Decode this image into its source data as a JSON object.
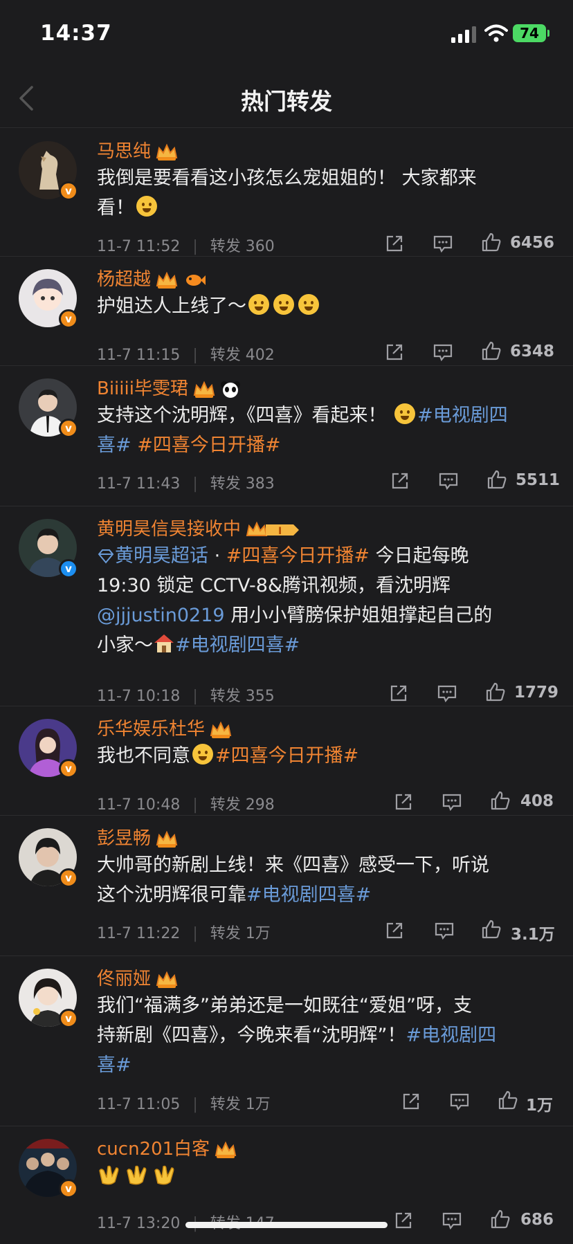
{
  "status": {
    "time": "14:37",
    "battery": "74"
  },
  "nav": {
    "title": "热门转发"
  },
  "posts": [
    {
      "name": "马思纯",
      "text_lines": [
        "我倒是要看看这小孩怎么宠姐姐的！ 大家都来",
        "看！"
      ],
      "date": "11-7 11:52",
      "repost": "转发 360",
      "likes": "6456",
      "verify": "orange"
    },
    {
      "name": "杨超越",
      "text": "护姐达人上线了～",
      "date": "11-7 11:15",
      "repost": "转发 402",
      "likes": "6348",
      "verify": "orange"
    },
    {
      "name": "Biiiii毕雯珺",
      "text_a": "支持这个沈明辉，《四喜》看起来！ ",
      "tag1": "#电视剧四",
      "tag1b": "喜#",
      "tag2": " #四喜今日开播#",
      "date": "11-7 11:43",
      "repost": "转发 383",
      "likes": "5511",
      "verify": "orange"
    },
    {
      "name": "黄明昊信昊接收中",
      "supertopic": "黄明昊超话",
      "dot": " · ",
      "tag1": "#四喜今日开播#",
      "text_a": " 今日起每晚",
      "line2": "19:30 锁定 CCTV-8&腾讯视频，看沈明辉",
      "mention": "@jjjustin0219",
      "text_b": " 用小小臂膀保护姐姐撑起自己的",
      "line4a": "小家～",
      "tag2": "#电视剧四喜#",
      "date": "11-7 10:18",
      "repost": "转发 355",
      "likes": "1779",
      "verify": "blue"
    },
    {
      "name": "乐华娱乐杜华",
      "text_a": "我也不同意",
      "tag1": "#四喜今日开播#",
      "date": "11-7 10:48",
      "repost": "转发 298",
      "likes": "408",
      "verify": "orange"
    },
    {
      "name": "彭昱畅",
      "line1": "大帅哥的新剧上线！来《四喜》感受一下，听说",
      "line2": "这个沈明辉很可靠",
      "tag1": "#电视剧四喜#",
      "date": "11-7 11:22",
      "repost": "转发 1万",
      "likes": "3.1万",
      "verify": "orange"
    },
    {
      "name": "佟丽娅",
      "line1": "我们“福满多”弟弟还是一如既往“爱姐”呀，支",
      "line2": "持新剧《四喜》，今晚来看“沈明辉”！",
      "tag1": "#电视剧四",
      "tag1b": "喜#",
      "date": "11-7 11:05",
      "repost": "转发 1万",
      "likes": "1万",
      "verify": "orange"
    },
    {
      "name": "cucn201白客",
      "date": "11-7 13:20",
      "repost": "转发 147",
      "likes": "686",
      "verify": "orange"
    }
  ]
}
